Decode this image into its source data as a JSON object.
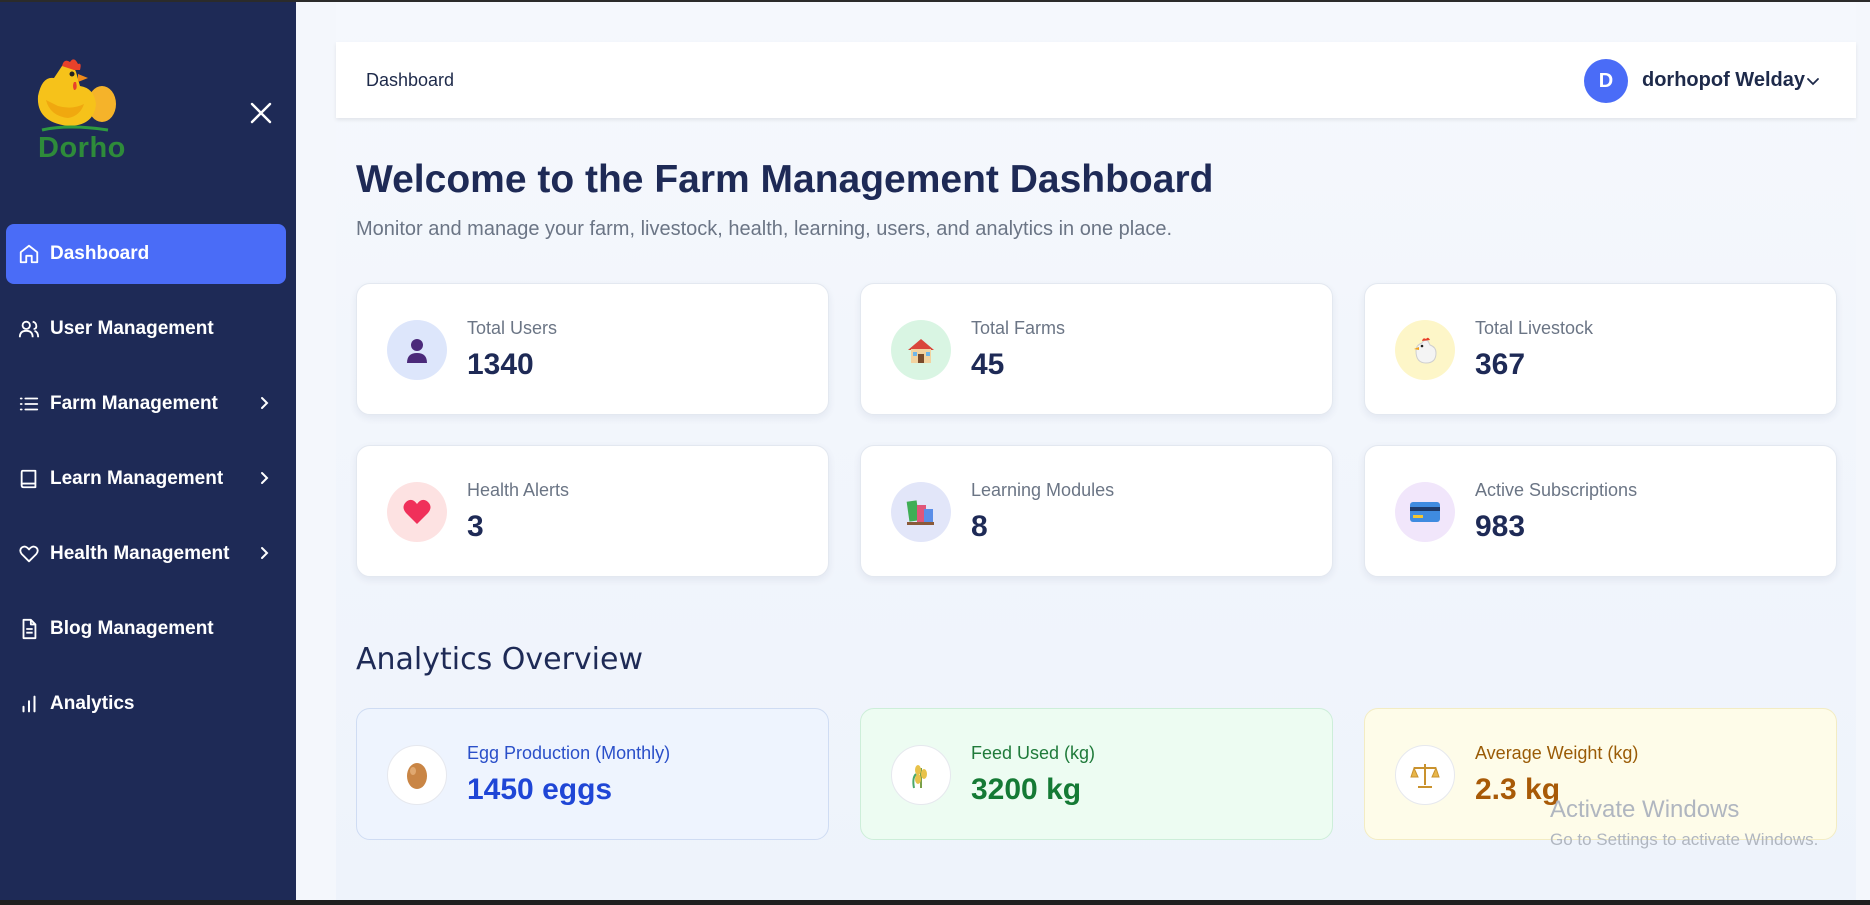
{
  "sidebar": {
    "logo_text": "Dorho",
    "items": [
      {
        "label": "Dashboard",
        "icon": "home-icon",
        "active": true,
        "has_chevron": false
      },
      {
        "label": "User Management",
        "icon": "users-icon",
        "active": false,
        "has_chevron": false
      },
      {
        "label": "Farm Management",
        "icon": "list-icon",
        "active": false,
        "has_chevron": true
      },
      {
        "label": "Learn Management",
        "icon": "book-icon",
        "active": false,
        "has_chevron": true
      },
      {
        "label": "Health Management",
        "icon": "heart-icon",
        "active": false,
        "has_chevron": true
      },
      {
        "label": "Blog Management",
        "icon": "document-icon",
        "active": false,
        "has_chevron": false
      },
      {
        "label": "Analytics",
        "icon": "bar-chart-icon",
        "active": false,
        "has_chevron": false
      }
    ]
  },
  "header": {
    "breadcrumb": "Dashboard",
    "avatar_initial": "D",
    "username": "dorhopof Welday"
  },
  "welcome": {
    "title": "Welcome to the Farm Management Dashboard",
    "subtitle": "Monitor and manage your farm, livestock, health, learning, users, and analytics in one place."
  },
  "stats": [
    {
      "label": "Total Users",
      "value": "1340",
      "icon": "user-icon",
      "glyph": "👤",
      "icon_bg": "#dde6fb"
    },
    {
      "label": "Total Farms",
      "value": "45",
      "icon": "house-icon",
      "glyph": "🏠",
      "icon_bg": "#d9f5e3"
    },
    {
      "label": "Total Livestock",
      "value": "367",
      "icon": "chicken-icon",
      "glyph": "🐔",
      "icon_bg": "#fdf6c8"
    },
    {
      "label": "Health Alerts",
      "value": "3",
      "icon": "heart-icon",
      "glyph": "❤️",
      "icon_bg": "#fde2e2"
    },
    {
      "label": "Learning Modules",
      "value": "8",
      "icon": "books-icon",
      "glyph": "📚",
      "icon_bg": "#e2e6f9"
    },
    {
      "label": "Active Subscriptions",
      "value": "983",
      "icon": "credit-card-icon",
      "glyph": "💳",
      "icon_bg": "#f1e6fb"
    }
  ],
  "analytics": {
    "title": "Analytics Overview",
    "cards": [
      {
        "label": "Egg Production (Monthly)",
        "value": "1450 eggs",
        "icon": "egg-icon",
        "glyph": "🥚",
        "bg": "#eef4fe",
        "border": "#cfdcf3",
        "label_color": "#2a4fc9",
        "value_color": "#1f46d6"
      },
      {
        "label": "Feed Used (kg)",
        "value": "3200 kg",
        "icon": "feed-icon",
        "glyph": "🌾",
        "bg": "#edfcf2",
        "border": "#cdeed9",
        "label_color": "#1f7a3a",
        "value_color": "#157a35"
      },
      {
        "label": "Average Weight (kg)",
        "value": "2.3 kg",
        "icon": "scale-icon",
        "glyph": "⚖️",
        "bg": "#fefce9",
        "border": "#f3ecc3",
        "label_color": "#9a5b06",
        "value_color": "#a85a07"
      }
    ]
  },
  "watermark": {
    "line1": "Activate Windows",
    "line2": "Go to Settings to activate Windows."
  },
  "colors": {
    "sidebar_bg": "#1e2a56",
    "accent": "#4a6cf7"
  }
}
